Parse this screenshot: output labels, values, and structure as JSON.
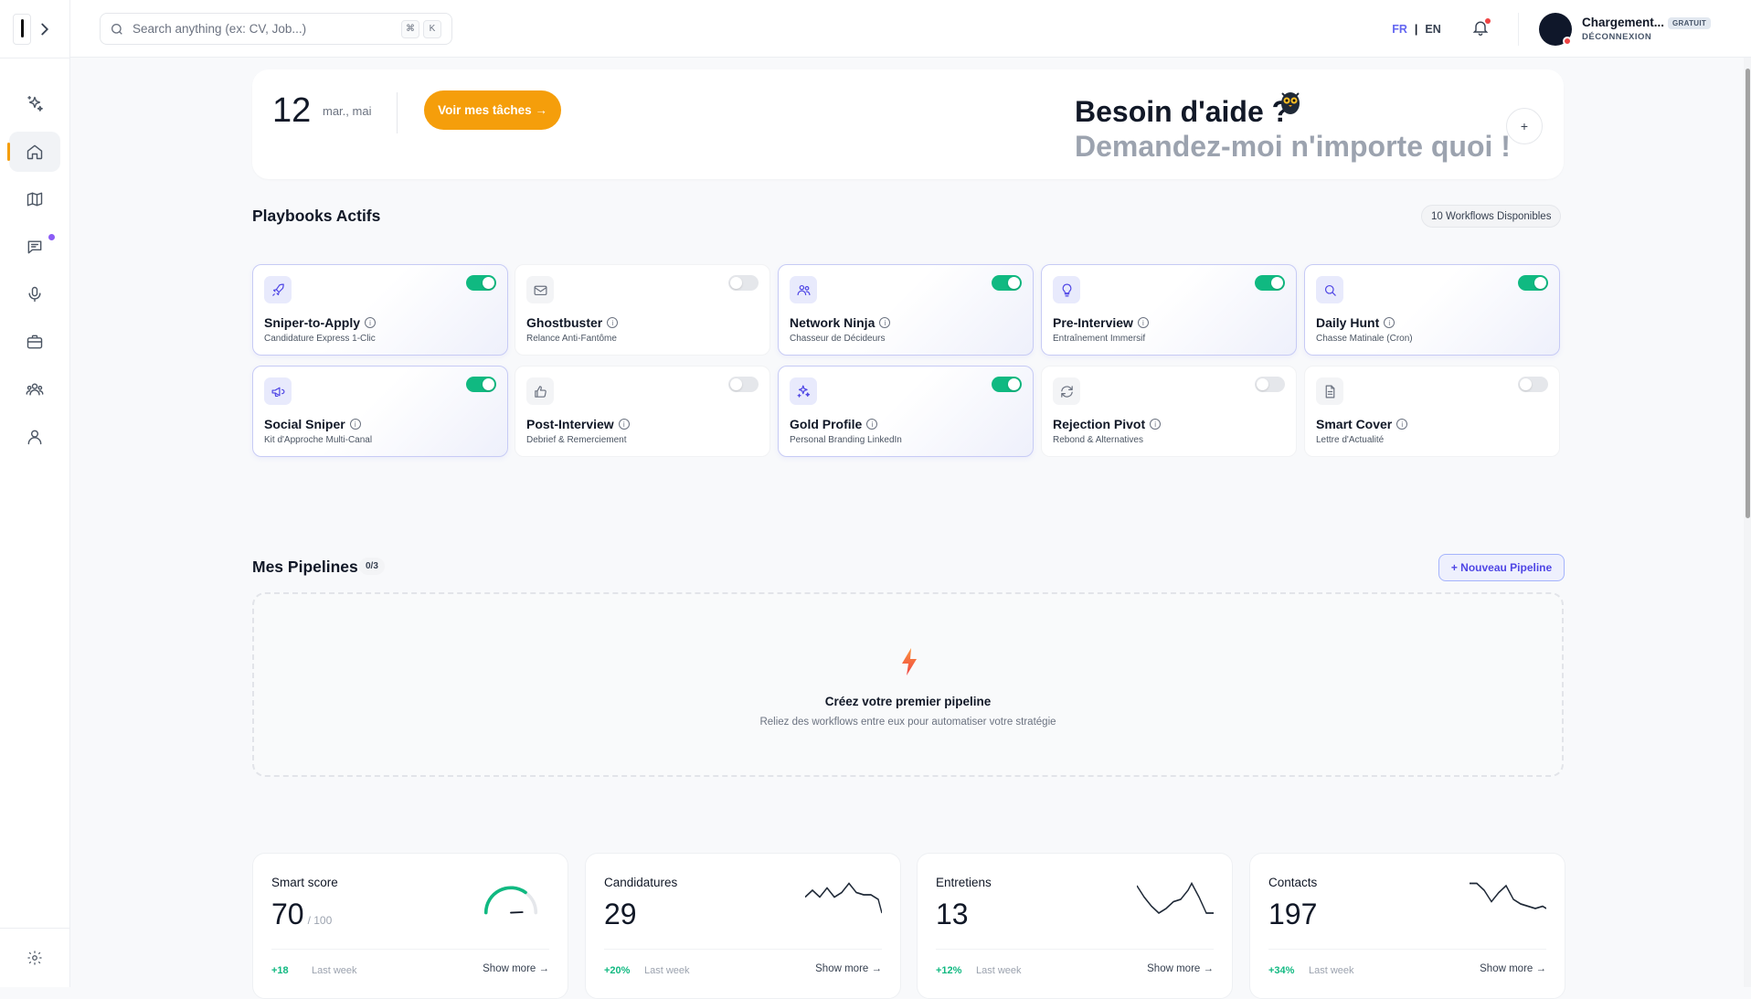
{
  "topbar": {
    "search_placeholder": "Search anything (ex: CV, Job...)",
    "shortcut_modifier": "⌘",
    "shortcut_key": "K",
    "lang_fr": "FR",
    "lang_sep": "|",
    "lang_en": "EN",
    "user_name": "Chargement...",
    "user_plan": "GRATUIT",
    "logout": "DÉCONNEXION"
  },
  "sidebar": {
    "items": [
      {
        "icon": "sparkles-icon"
      },
      {
        "icon": "home-icon",
        "active": true
      },
      {
        "icon": "map-icon"
      },
      {
        "icon": "chat-icon",
        "notification": true
      },
      {
        "icon": "microphone-icon"
      },
      {
        "icon": "briefcase-icon"
      },
      {
        "icon": "users-icon"
      },
      {
        "icon": "user-icon"
      }
    ],
    "settings_icon": "gear-icon"
  },
  "hero": {
    "day": "12",
    "dayname": "mar., mai",
    "tasks_button": "Voir mes tâches →",
    "help_title": "Besoin d'aide ?",
    "help_subtitle": "Demandez-moi n'importe quoi !",
    "plus": "+"
  },
  "playbooks": {
    "title": "Playbooks Actifs",
    "badge": "10 Workflows Disponibles",
    "items": [
      {
        "name": "Sniper-to-Apply",
        "sub": "Candidature Express 1-Clic",
        "on": true,
        "icon": "rocket-icon"
      },
      {
        "name": "Ghostbuster",
        "sub": "Relance Anti-Fantôme",
        "on": false,
        "icon": "mail-icon"
      },
      {
        "name": "Network Ninja",
        "sub": "Chasseur de Décideurs",
        "on": true,
        "icon": "users-icon"
      },
      {
        "name": "Pre-Interview",
        "sub": "Entraînement Immersif",
        "on": true,
        "icon": "lightbulb-icon"
      },
      {
        "name": "Daily Hunt",
        "sub": "Chasse Matinale (Cron)",
        "on": true,
        "icon": "search-icon"
      },
      {
        "name": "Social Sniper",
        "sub": "Kit d'Approche Multi-Canal",
        "on": true,
        "icon": "megaphone-icon"
      },
      {
        "name": "Post-Interview",
        "sub": "Debrief & Remerciement",
        "on": false,
        "icon": "thumbs-up-icon"
      },
      {
        "name": "Gold Profile",
        "sub": "Personal Branding LinkedIn",
        "on": true,
        "icon": "sparkles-icon"
      },
      {
        "name": "Rejection Pivot",
        "sub": "Rebond & Alternatives",
        "on": false,
        "icon": "refresh-icon"
      },
      {
        "name": "Smart Cover",
        "sub": "Lettre d'Actualité",
        "on": false,
        "icon": "document-icon"
      }
    ]
  },
  "pipelines": {
    "title": "Mes Pipelines",
    "count": "0/3",
    "new_button": "+ Nouveau Pipeline",
    "empty_title": "Créez votre premier pipeline",
    "empty_sub": "Reliez des workflows entre eux pour automatiser votre stratégie"
  },
  "stats": [
    {
      "label": "Smart score",
      "value": "70",
      "suffix": "/ 100",
      "delta": "+18",
      "period": "Last week",
      "more": "Show more →",
      "graph": "gauge",
      "gauge_fraction": 0.7
    },
    {
      "label": "Candidatures",
      "value": "29",
      "suffix": "",
      "delta": "+20%",
      "period": "Last week",
      "more": "Show more →",
      "graph": "sparkline"
    },
    {
      "label": "Entretiens",
      "value": "13",
      "suffix": "",
      "delta": "+12%",
      "period": "Last week",
      "more": "Show more →",
      "graph": "sparkline"
    },
    {
      "label": "Contacts",
      "value": "197",
      "suffix": "",
      "delta": "+34%",
      "period": "Last week",
      "more": "Show more →",
      "graph": "sparkline"
    }
  ],
  "colors": {
    "accent": "#f59e0b",
    "primary": "#4f46e5",
    "toggle_on": "#10b981",
    "delta": "#10b981"
  }
}
